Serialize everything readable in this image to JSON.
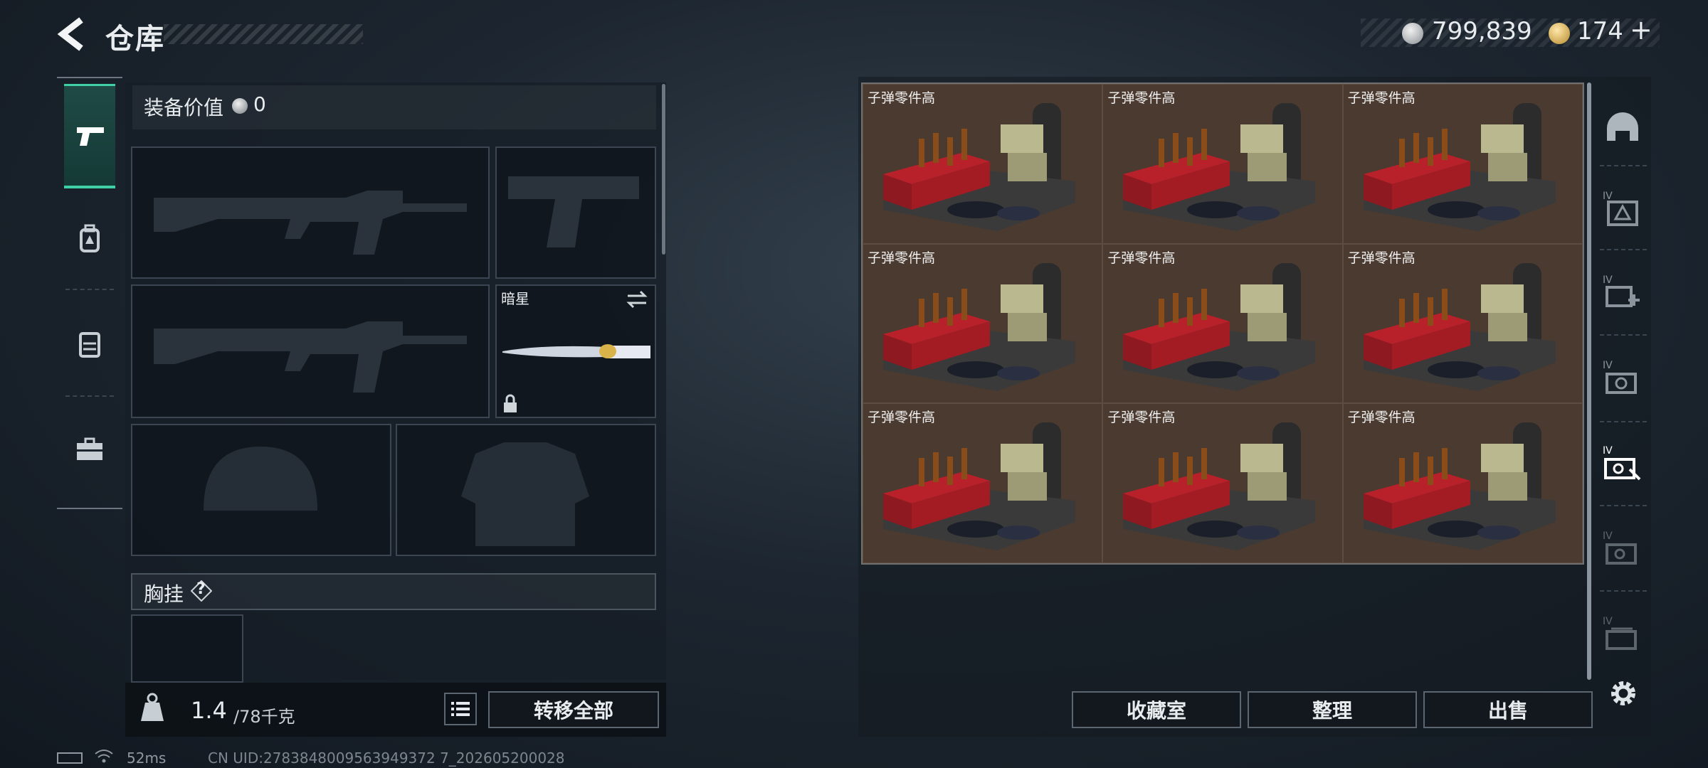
{
  "header": {
    "title": "仓库"
  },
  "currency": {
    "silver": "799,839",
    "gold": "174",
    "gold_plus": "+"
  },
  "equipment": {
    "value_label": "装备价值",
    "value": "0",
    "melee_name": "暗星",
    "rig_label": "胸挂",
    "rig_help": "?"
  },
  "weight": {
    "current": "1.4",
    "max": "/78千克"
  },
  "buttons": {
    "transfer_all": "转移全部",
    "collection": "收藏室",
    "sort": "整理",
    "sell": "出售"
  },
  "storage": {
    "items": [
      {
        "label": "子弹零件高"
      },
      {
        "label": "子弹零件高"
      },
      {
        "label": "子弹零件高"
      },
      {
        "label": "子弹零件高"
      },
      {
        "label": "子弹零件高"
      },
      {
        "label": "子弹零件高"
      },
      {
        "label": "子弹零件高"
      },
      {
        "label": "子弹零件高"
      },
      {
        "label": "子弹零件高"
      }
    ]
  },
  "status": {
    "ping": "52ms",
    "uid": "CN UID:2783848009563949372 7_202605200028"
  },
  "icons": {
    "back": "back-arrow-icon",
    "coin_silver": "silver-coin-icon",
    "coin_gold": "gold-coin-icon",
    "rail": [
      "pistol-icon",
      "backpack-icon",
      "vest-icon",
      "toolbox-icon"
    ],
    "right_rail": [
      "helmet-icon",
      "case-iv-icon",
      "medkit-iv-icon",
      "camera-iv-icon",
      "key-iv-icon",
      "key-iv-dim-icon",
      "card-iv-icon"
    ],
    "settings": "gear-icon"
  }
}
